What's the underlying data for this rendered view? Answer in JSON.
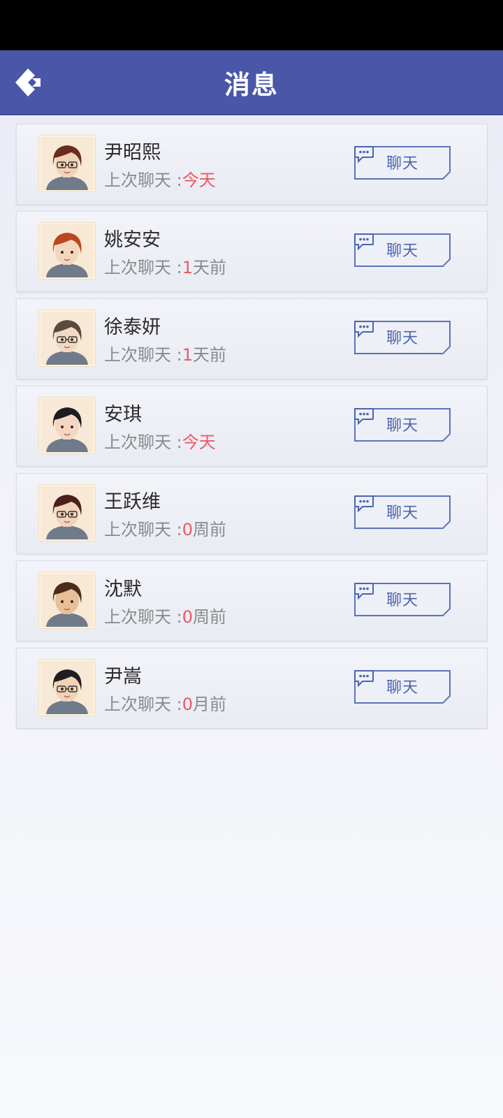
{
  "header": {
    "title": "消息"
  },
  "list_prefix": "上次聊天 :",
  "chat_label": "聊天",
  "contacts": [
    {
      "name": "尹昭熙",
      "value": "今天",
      "unit": "",
      "hair": "#6b2b1f",
      "skin": "#f2d2b6",
      "glasses": true
    },
    {
      "name": "姚安安",
      "value": "1",
      "unit": "天前",
      "hair": "#b9471f",
      "skin": "#f3d6bd",
      "glasses": false
    },
    {
      "name": "徐泰妍",
      "value": "1",
      "unit": "天前",
      "hair": "#5a4a40",
      "skin": "#f3d9c2",
      "glasses": true
    },
    {
      "name": "安琪",
      "value": "今天",
      "unit": "",
      "hair": "#1c1b22",
      "skin": "#f3d7c3",
      "glasses": false
    },
    {
      "name": "王跃维",
      "value": "0",
      "unit": "周前",
      "hair": "#4a1f1c",
      "skin": "#f2d3bb",
      "glasses": true
    },
    {
      "name": "沈默",
      "value": "0",
      "unit": "周前",
      "hair": "#4a2c1b",
      "skin": "#e9bf98",
      "glasses": false
    },
    {
      "name": "尹嵩",
      "value": "0",
      "unit": "月前",
      "hair": "#1e1e22",
      "skin": "#f0d2b6",
      "glasses": true
    }
  ]
}
